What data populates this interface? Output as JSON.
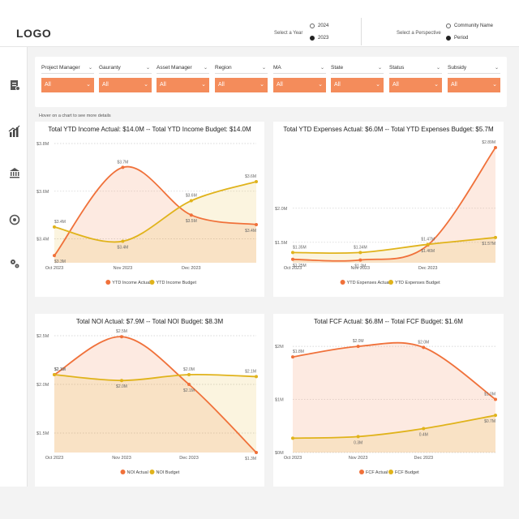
{
  "header": {
    "logo": "LOGO",
    "year_label": "Select a Year",
    "year_options": [
      {
        "label": "2024",
        "selected": false
      },
      {
        "label": "2023",
        "selected": true
      }
    ],
    "perspective_label": "Select a Perspective",
    "perspective_options": [
      {
        "label": "Community Name",
        "selected": false
      },
      {
        "label": "Period",
        "selected": true
      }
    ]
  },
  "sidebar": {
    "items": [
      {
        "icon": "document-icon",
        "active": false
      },
      {
        "icon": "bar-chart-icon",
        "active": true
      },
      {
        "icon": "bank-icon",
        "active": false
      },
      {
        "icon": "at-sign-icon",
        "active": false
      },
      {
        "icon": "gears-icon",
        "active": false
      }
    ]
  },
  "filters": [
    {
      "label": "Project Manager",
      "value": "All"
    },
    {
      "label": "Gauranty",
      "value": "All"
    },
    {
      "label": "Asset Manager",
      "value": "All"
    },
    {
      "label": "Region",
      "value": "All"
    },
    {
      "label": "MA",
      "value": "All"
    },
    {
      "label": "State",
      "value": "All"
    },
    {
      "label": "Status",
      "value": "All"
    },
    {
      "label": "Subsidy",
      "value": "All"
    }
  ],
  "hint": "Hover on a chart to see more details",
  "colors": {
    "actual": "#f0713a",
    "budget": "#e0b31b",
    "filter": "#f48c5b"
  },
  "chart_data": [
    {
      "type": "area",
      "title": "Total YTD Income Actual: $14.0M -- Total YTD Income Budget: $14.0M",
      "categories": [
        "Oct 2023",
        "Nov 2023",
        "Dec 2023"
      ],
      "x": [
        0,
        1,
        2,
        2.95
      ],
      "ylim": [
        3.3,
        3.8
      ],
      "yticks": [
        {
          "v": 3.8,
          "l": "$3.8M"
        },
        {
          "v": 3.6,
          "l": "$3.6M"
        },
        {
          "v": 3.4,
          "l": "$3.4M"
        }
      ],
      "series": [
        {
          "name": "YTD Income Actual",
          "values": [
            3.33,
            3.7,
            3.5,
            3.46
          ],
          "labels": [
            "$3.3M",
            "$3.7M",
            "$3.5M",
            "$3.4M"
          ]
        },
        {
          "name": "YTD Income Budget",
          "values": [
            3.45,
            3.39,
            3.56,
            3.64
          ],
          "labels": [
            "$3.4M",
            "$3.4M",
            "$3.6M",
            "$3.6M"
          ]
        }
      ]
    },
    {
      "type": "area",
      "title": "Total YTD Expenses Actual: $6.0M -- Total YTD Expenses Budget: $5.7M",
      "categories": [
        "Oct 2023",
        "Nov 2023",
        "Dec 2023"
      ],
      "x": [
        0,
        1,
        2,
        3
      ],
      "ylim": [
        1.2,
        2.95
      ],
      "yticks": [
        {
          "v": 2.0,
          "l": "$2.0M"
        },
        {
          "v": 1.5,
          "l": "$1.5M"
        }
      ],
      "series": [
        {
          "name": "YTD Expenses Actual",
          "values": [
            1.25,
            1.24,
            1.46,
            2.89
          ],
          "labels": [
            "$1.25M",
            "$1.2M",
            "$1.46M",
            "$2.89M"
          ]
        },
        {
          "name": "YTD Expenses Budget",
          "values": [
            1.35,
            1.35,
            1.47,
            1.57
          ],
          "labels": [
            "$1.35M",
            "$1.34M",
            "$1.47M",
            "$1.57M"
          ]
        }
      ]
    },
    {
      "type": "area",
      "title": "Total NOI Actual: $7.9M -- Total NOI Budget: $8.3M",
      "categories": [
        "Oct 2023",
        "Nov 2023",
        "Dec 2023"
      ],
      "x": [
        0,
        1,
        2,
        3
      ],
      "ylim": [
        1.3,
        2.5
      ],
      "yticks": [
        {
          "v": 2.5,
          "l": "$2.5M"
        },
        {
          "v": 2.0,
          "l": "$2.0M"
        },
        {
          "v": 1.5,
          "l": "$1.5M"
        }
      ],
      "series": [
        {
          "name": "NOI Actual",
          "values": [
            2.1,
            2.49,
            2.0,
            1.3
          ],
          "labels": [
            "$2.1M",
            "$2.5M",
            "$2.1M",
            "$1.3M"
          ]
        },
        {
          "name": "NOI Budget",
          "values": [
            2.1,
            2.04,
            2.1,
            2.08
          ],
          "labels": [
            "$2.1M",
            "$2.0M",
            "$2.0M",
            "$2.1M"
          ]
        }
      ]
    },
    {
      "type": "area",
      "title": "Total FCF Actual: $6.8M -- Total FCF Budget: $1.6M",
      "categories": [
        "Oct 2023",
        "Nov 2023",
        "Dec 2023"
      ],
      "x": [
        0,
        1,
        2,
        3.1
      ],
      "ylim": [
        0,
        2.2
      ],
      "yticks": [
        {
          "v": 2.0,
          "l": "$2M"
        },
        {
          "v": 1.0,
          "l": "$1M"
        },
        {
          "v": 0,
          "l": "$0M"
        }
      ],
      "series": [
        {
          "name": "FCF Actual",
          "values": [
            1.8,
            2.0,
            1.98,
            1.0
          ],
          "labels": [
            "$1.8M",
            "$2.0M",
            "$2.0M",
            "$1.0M"
          ]
        },
        {
          "name": "FCF Budget",
          "values": [
            0.27,
            0.3,
            0.45,
            0.7
          ],
          "labels": [
            "",
            "0.3M",
            "0.4M",
            "$0.7M"
          ]
        }
      ]
    }
  ]
}
